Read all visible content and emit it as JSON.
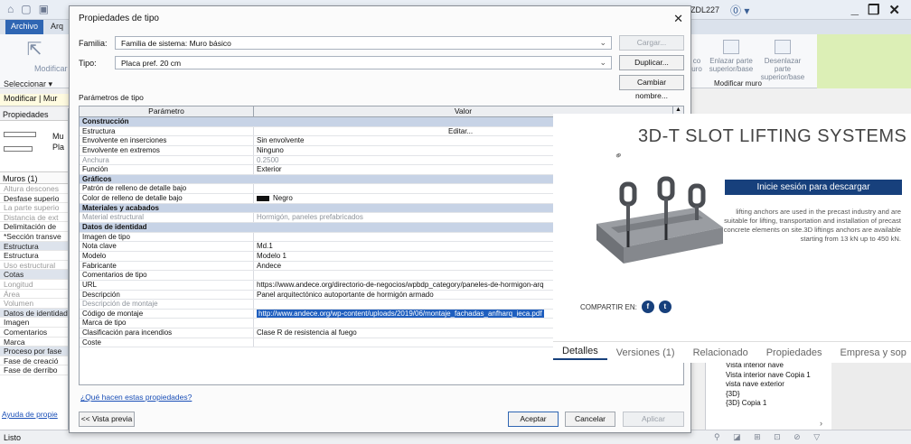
{
  "revit": {
    "user": "ZDL227",
    "tab_archivo": "Archivo",
    "tab_arq": "Arq",
    "modificar_tool": "Modificar",
    "seleccionar": "Seleccionar ▾",
    "modificar_context": "Modificar | Mur",
    "ribbon_btn1": "co\nuro",
    "ribbon_btn2": "Enlazar parte superior/base",
    "ribbon_btn3": "Desenlazar parte superior/base",
    "ribbon_group": "Modificar muro",
    "status": "Listo"
  },
  "palette": {
    "title": "Propiedades",
    "type_line1": "Mu",
    "type_line2": "Pla",
    "category": "Muros (1)",
    "rows": [
      {
        "t": "Altura descones",
        "s": "grey"
      },
      {
        "t": "Desfase superio",
        "s": ""
      },
      {
        "t": "La parte superio",
        "s": "grey"
      },
      {
        "t": "Distancia de ext",
        "s": "grey"
      },
      {
        "t": "Delimitación de",
        "s": ""
      },
      {
        "t": "*Sección transve",
        "s": ""
      },
      {
        "t": "Estructura",
        "s": "head"
      },
      {
        "t": "Estructura",
        "s": ""
      },
      {
        "t": "Uso estructural",
        "s": "grey"
      },
      {
        "t": "Cotas",
        "s": "head"
      },
      {
        "t": "Longitud",
        "s": "grey"
      },
      {
        "t": "Área",
        "s": "grey"
      },
      {
        "t": "Volumen",
        "s": "grey"
      },
      {
        "t": "Datos de identidad",
        "s": "head"
      },
      {
        "t": "Imagen",
        "s": ""
      },
      {
        "t": "Comentarios",
        "s": ""
      },
      {
        "t": "Marca",
        "s": ""
      },
      {
        "t": "Proceso por fase",
        "s": "head"
      },
      {
        "t": "Fase de creació",
        "s": ""
      },
      {
        "t": "Fase de derribo",
        "s": ""
      }
    ],
    "help_link": "Ayuda de propie"
  },
  "dialog": {
    "title": "Propiedades de tipo",
    "familia_label": "Familia:",
    "familia_value": "Familia de sistema: Muro básico",
    "tipo_label": "Tipo:",
    "tipo_value": "Placa pref. 20 cm",
    "cargar": "Cargar...",
    "duplicar": "Duplicar...",
    "cambiar_nombre": "Cambiar nombre...",
    "params_label": "Parámetros de tipo",
    "col_param": "Parámetro",
    "col_valor": "Valor",
    "rows": [
      {
        "p": "Construcción",
        "v": "",
        "k": "grp"
      },
      {
        "p": "Estructura",
        "v": "Editar...",
        "k": "edit"
      },
      {
        "p": "Envolvente en inserciones",
        "v": "Sin envolvente",
        "k": ""
      },
      {
        "p": "Envolvente en extremos",
        "v": "Ninguno",
        "k": ""
      },
      {
        "p": "Anchura",
        "v": "0.2500",
        "k": "grey"
      },
      {
        "p": "Función",
        "v": "Exterior",
        "k": ""
      },
      {
        "p": "Gráficos",
        "v": "",
        "k": "grp"
      },
      {
        "p": "Patrón de relleno de detalle bajo",
        "v": "",
        "k": ""
      },
      {
        "p": "Color de relleno de detalle bajo",
        "v": "Negro",
        "k": "color"
      },
      {
        "p": "Materiales y acabados",
        "v": "",
        "k": "grp"
      },
      {
        "p": "Material estructural",
        "v": "Hormigón, paneles prefabricados",
        "k": "grey"
      },
      {
        "p": "Datos de identidad",
        "v": "",
        "k": "grp"
      },
      {
        "p": "Imagen de tipo",
        "v": "",
        "k": ""
      },
      {
        "p": "Nota clave",
        "v": "Md.1",
        "k": ""
      },
      {
        "p": "Modelo",
        "v": "Modelo 1",
        "k": ""
      },
      {
        "p": "Fabricante",
        "v": "Andece",
        "k": ""
      },
      {
        "p": "Comentarios de tipo",
        "v": "",
        "k": ""
      },
      {
        "p": "URL",
        "v": "https://www.andece.org/directorio-de-negocios/wpbdp_category/paneles-de-hormigon-arq",
        "k": ""
      },
      {
        "p": "Descripción",
        "v": "Panel arquitectónico autoportante de hormigón armado",
        "k": ""
      },
      {
        "p": "Descripción de montaje",
        "v": "",
        "k": "grey"
      },
      {
        "p": "Código de montaje",
        "v": "http://www.andece.org/wp-content/uploads/2019/06/montaje_fachadas_anfharq_ieca.pdf",
        "k": "sel"
      },
      {
        "p": "Marca de tipo",
        "v": "",
        "k": ""
      },
      {
        "p": "Clasificación para incendios",
        "v": "Clase R de resistencia al fuego",
        "k": ""
      },
      {
        "p": "Coste",
        "v": "",
        "k": ""
      }
    ],
    "help_link": "¿Qué hacen estas propiedades?",
    "preview_btn": "<< Vista previa",
    "aceptar": "Aceptar",
    "cancelar": "Cancelar",
    "aplicar": "Aplicar"
  },
  "web": {
    "title": "3D-T SLOT LIFTING SYSTEMS",
    "login_btn": "Inicie sesión para descargar",
    "description": "lifting anchors are used in the precast industry and are suitable for lifting, transportation and installation of precast concrete elements on site.3D liftings anchors are available starting from 13 kN up to 450 kN.",
    "share_label": "COMPARTIR EN:",
    "tabs": [
      "Detalles",
      "Versiones (1)",
      "Relacionado",
      "Propiedades",
      "Empresa y sop"
    ]
  },
  "browser": {
    "items": [
      "Vista interior nave",
      "Vista interior nave Copia 1",
      "vista nave exterior",
      "{3D}",
      "{3D} Copia 1"
    ]
  }
}
